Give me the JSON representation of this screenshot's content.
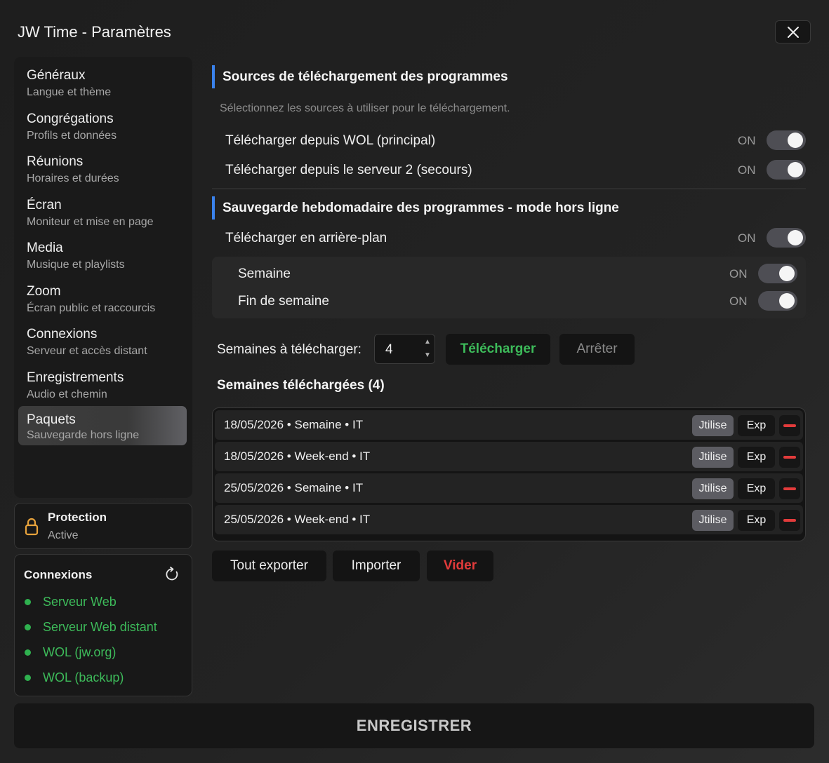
{
  "window": {
    "title": "JW Time - Paramètres"
  },
  "sidebar": {
    "items": [
      {
        "title": "Généraux",
        "subtitle": "Langue et thème"
      },
      {
        "title": "Congrégations",
        "subtitle": "Profils et données"
      },
      {
        "title": "Réunions",
        "subtitle": "Horaires et durées"
      },
      {
        "title": "Écran",
        "subtitle": "Moniteur et mise en page"
      },
      {
        "title": "Media",
        "subtitle": "Musique et playlists"
      },
      {
        "title": "Zoom",
        "subtitle": "Écran public et raccourcis"
      },
      {
        "title": "Connexions",
        "subtitle": "Serveur et accès distant"
      },
      {
        "title": "Enregistrements",
        "subtitle": "Audio et chemin"
      },
      {
        "title": "Paquets",
        "subtitle": "Sauvegarde hors ligne",
        "active": true
      }
    ]
  },
  "protection": {
    "title": "Protection",
    "status": "Active"
  },
  "connections": {
    "title": "Connexions",
    "items": [
      {
        "label": "Serveur Web",
        "status": "online"
      },
      {
        "label": "Serveur Web distant",
        "status": "online"
      },
      {
        "label": "WOL (jw.org)",
        "status": "online"
      },
      {
        "label": "WOL (backup)",
        "status": "online"
      }
    ]
  },
  "sources": {
    "header": "Sources de téléchargement des programmes",
    "description": "Sélectionnez les sources à utiliser pour le téléchargement.",
    "options": [
      {
        "label": "Télécharger depuis WOL (principal)",
        "state": "ON"
      },
      {
        "label": "Télécharger depuis le serveur 2 (secours)",
        "state": "ON"
      }
    ]
  },
  "backup": {
    "header": "Sauvegarde hebdomadaire des programmes - mode hors ligne",
    "background": {
      "label": "Télécharger en arrière-plan",
      "state": "ON"
    },
    "sub_options": [
      {
        "label": "Semaine",
        "state": "ON"
      },
      {
        "label": "Fin de semaine",
        "state": "ON"
      }
    ],
    "weeks_label": "Semaines à télécharger:",
    "weeks_value": "4",
    "download_button": "Télécharger",
    "stop_button": "Arrêter"
  },
  "downloaded": {
    "title": "Semaines téléchargées (4)",
    "use_label": "Jtilise",
    "export_label": "Exp",
    "rows": [
      "18/05/2026 • Semaine • IT",
      "18/05/2026 • Week-end • IT",
      "25/05/2026 • Semaine • IT",
      "25/05/2026 • Week-end • IT"
    ]
  },
  "actions": {
    "export_all": "Tout exporter",
    "import": "Importer",
    "clear": "Vider"
  },
  "footer": {
    "save": "ENREGISTRER"
  },
  "colors": {
    "accent": "#3a82ec",
    "success": "#3dbb5a",
    "danger": "#e23b3b",
    "lock": "#e8a33c"
  }
}
